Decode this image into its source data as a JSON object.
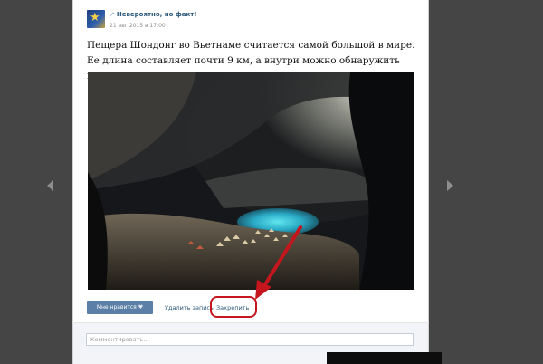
{
  "post": {
    "author": "Невероятно, но факт!",
    "date": "21 авг 2015 в 17:00",
    "text": "Пещера Шондонг во Вьетнаме считается самой большой в мире. Ее длина составляет почти 9 км, а внутри можно обнаружить целые джунгли и реку."
  },
  "actions": {
    "like_label": "Мне нравится",
    "delete_label": "Удалить запись",
    "pin_label": "Закрепить"
  },
  "comment": {
    "placeholder": "Комментировать.."
  },
  "colors": {
    "link": "#2b587a",
    "like_button": "#5b7fa6",
    "highlight": "#c4161c",
    "overlay": "#454545"
  },
  "icons": {
    "prev": "chevron-left-icon",
    "next": "chevron-right-icon",
    "like": "heart-icon",
    "external": "external-link-icon"
  }
}
